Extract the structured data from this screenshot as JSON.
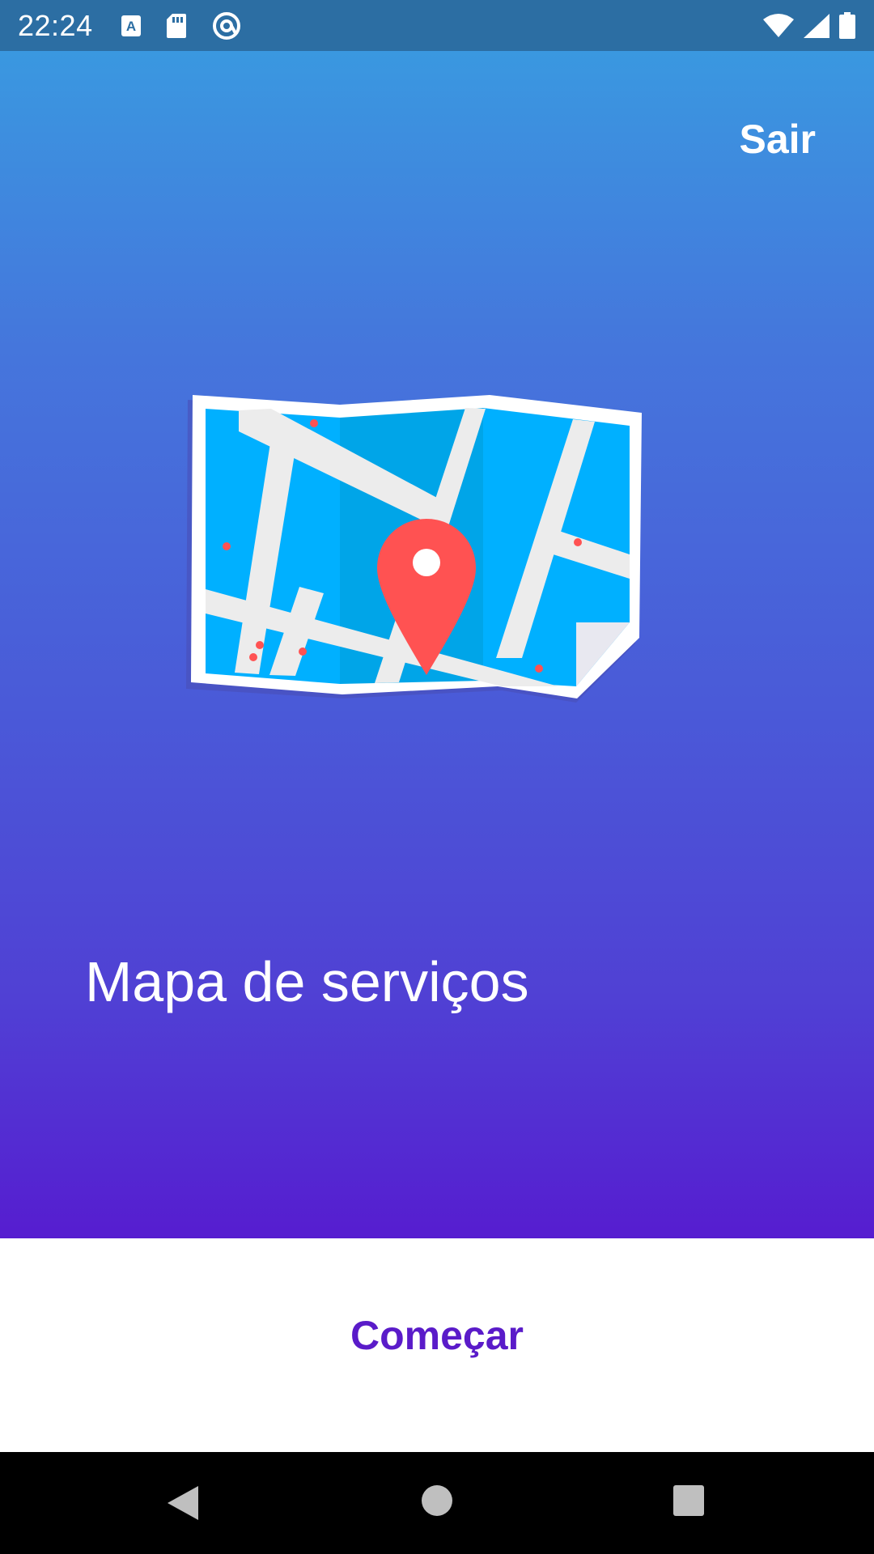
{
  "status_bar": {
    "time": "22:24",
    "icons_left": [
      "keyboard-a-icon",
      "sd-card-icon",
      "vpn-at-icon"
    ],
    "icons_right": [
      "wifi-icon",
      "signal-icon",
      "battery-icon"
    ]
  },
  "header": {
    "exit_label": "Sair"
  },
  "main": {
    "illustration": "map-with-location-pin-icon",
    "title": "Mapa de serviços"
  },
  "bottom": {
    "start_label": "Começar"
  },
  "colors": {
    "gradient_top": "#3a98e0",
    "gradient_bottom": "#561dd0",
    "accent": "#5a1bc9",
    "map_water": "#00b0ff",
    "pin": "#ff5252"
  },
  "nav_bar": {
    "buttons": [
      "back-icon",
      "home-icon",
      "recents-icon"
    ]
  }
}
